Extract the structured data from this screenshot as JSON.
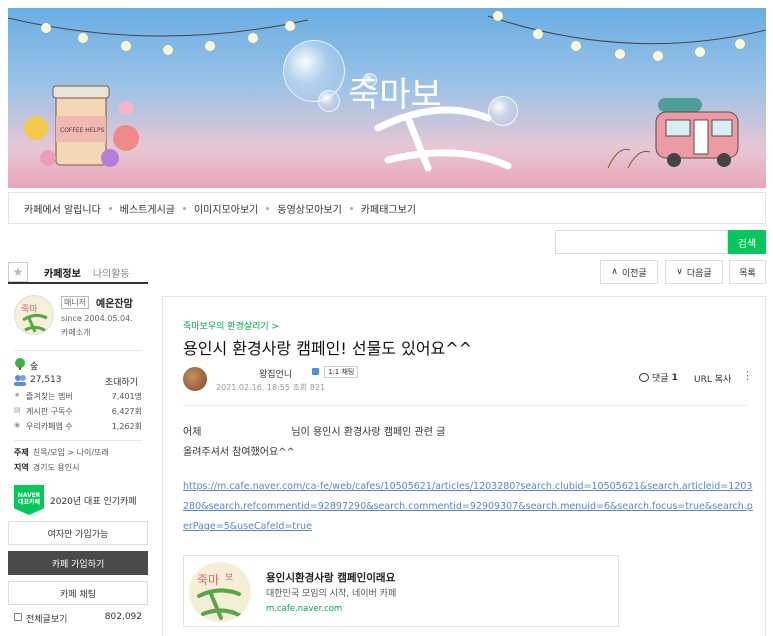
{
  "banner": {
    "logo_text": "죽마보"
  },
  "menu": {
    "items": [
      {
        "label": "카페에서 알립니다"
      },
      {
        "label": "베스트게시글"
      },
      {
        "label": "이미지모아보기"
      },
      {
        "label": "동영상모아보기"
      },
      {
        "label": "카페태그보기"
      }
    ]
  },
  "search": {
    "button_label": "검색",
    "placeholder": ""
  },
  "sidebar": {
    "tabs": {
      "cafe_info": "카페정보",
      "my_activity": "나의활동"
    },
    "profile": {
      "role": "매니저",
      "name": "예은잔맘",
      "since": "since 2004.05.04.",
      "intro": "카페소개"
    },
    "level": "숲",
    "members": {
      "count": "27,513",
      "invite": "초대하기"
    },
    "stats": [
      {
        "icon": "★",
        "label": "즐겨찾는 멤버",
        "value": "7,401명"
      },
      {
        "icon": "▤",
        "label": "게시판 구독수",
        "value": "6,427회"
      },
      {
        "icon": "◉",
        "label": "우리카페앱 수",
        "value": "1,262회"
      }
    ],
    "topic": {
      "label": "주제",
      "value": "친목/모임 > 나이/또래"
    },
    "region": {
      "label": "지역",
      "value": "경기도 용인시"
    },
    "award": {
      "badge_line1": "NAVER",
      "badge_line2": "대표카페",
      "text": "2020년 대표 인기카페"
    },
    "join_condition": "여자만 가입가능",
    "join_button": "카페 가입하기",
    "chat_button": "카페 채팅",
    "all_posts": {
      "label": "전체글보기",
      "value": "802,092"
    }
  },
  "article_nav": {
    "prev": "이전글",
    "next": "다음글",
    "list": "목록"
  },
  "article": {
    "board": "죽마보우의 환경살리기 >",
    "title": "용인시 환경사랑 캠페인! 선물도 있어요^^",
    "author": "왕집언니",
    "chat_badge": "1:1 채팅",
    "date": "2021.02.16. 18:55",
    "views_label": "조회",
    "views": "821",
    "comment_label": "댓글",
    "comment_count": "1",
    "url_copy": "URL 복사",
    "body_prefix": "어제",
    "body_suffix": "님이 용인시 환경사랑 캠페인 관련 글",
    "body_line2": "올려주셔서 참여했어요^^",
    "link": "https://m.cafe.naver.com/ca-fe/web/cafes/10505621/articles/1203280?search.clubid=10505621&search.articleid=1203280&search.refcommentid=92897290&search.commentid=92909307&search.menuid=6&search.focus=true&search.perPage=5&useCafeId=true",
    "og": {
      "title": "용인시환경사랑 캠페인이래요",
      "desc": "대한민국 모임의 시작, 네이버 카페",
      "url": "m.cafe.naver.com"
    }
  },
  "colors": {
    "accent": "#03c75a",
    "link": "#5a87c5"
  }
}
